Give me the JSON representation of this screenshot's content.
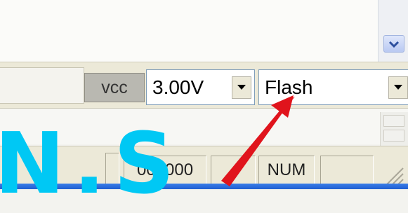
{
  "toolbar": {
    "vcc_label": "vcc",
    "voltage_value": "3.00V",
    "memory_value": "Flash"
  },
  "status_bar": {
    "address": "000000",
    "num_indicator": "NUM"
  },
  "watermark_text": "N.S",
  "colors": {
    "toolbar_bg": "#ece9d8",
    "arrow_red": "#e0141c",
    "watermark_cyan": "#00c8f4",
    "taskbar_blue": "#2a6ee0"
  },
  "icons": {
    "scroll_down": "chevron-down-icon",
    "dropdown": "triangle-down-icon",
    "size_grip": "resize-grip-icon"
  }
}
